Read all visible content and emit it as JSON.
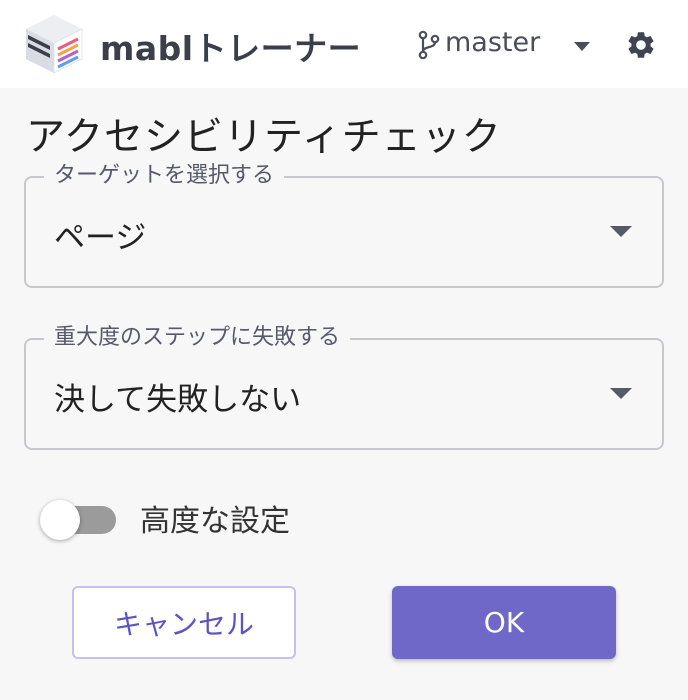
{
  "header": {
    "app_title": "mablトレーナー",
    "branch": "master",
    "icons": {
      "logo": "mabl-logo-icon",
      "branch": "git-branch-icon",
      "branch_dropdown": "caret-down-icon",
      "settings": "gear-icon"
    }
  },
  "dialog": {
    "title": "アクセシビリティチェック",
    "target_field": {
      "label": "ターゲットを選択する",
      "value": "ページ"
    },
    "severity_field": {
      "label": "重大度のステップに失敗する",
      "value": "決して失敗しない"
    },
    "advanced_toggle": {
      "label": "高度な設定",
      "enabled": false
    },
    "buttons": {
      "cancel": "キャンセル",
      "ok": "OK"
    }
  },
  "colors": {
    "primary": "#6f68c8",
    "cancel_text": "#5b55c0",
    "toggle_off": "#9b9b9b",
    "border": "#c7c7cc"
  }
}
